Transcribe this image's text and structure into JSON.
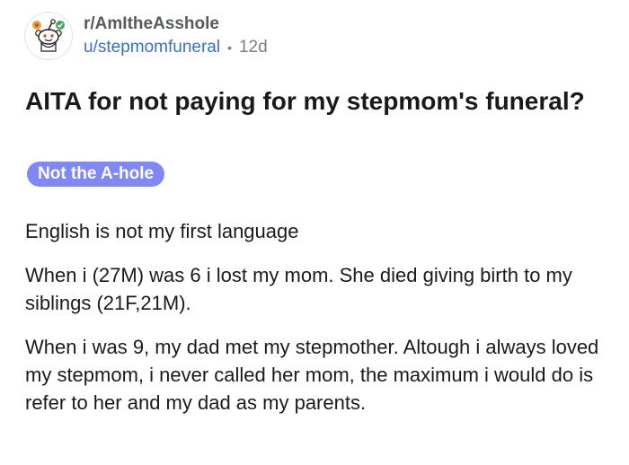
{
  "header": {
    "subreddit": "r/AmItheAsshole",
    "username": "u/stepmomfuneral",
    "separator": "•",
    "age": "12d",
    "avatar_icon": "reddit-snoo-avatar-icon"
  },
  "post": {
    "title": "AITA for not paying for my stepmom's funeral?",
    "flair": {
      "label": "Not the A-hole",
      "color": "#8088f5"
    },
    "paragraphs": [
      "English is not my first language",
      "When i (27M) was 6 i lost my mom. She died giving birth to my siblings (21F,21M).",
      "When i was 9, my dad met my stepmother. Altough i always loved my stepmom, i never called her mom, the maximum i would do is refer to her and my dad as my parents."
    ]
  },
  "colors": {
    "link": "#3a6fc4",
    "muted": "#7c7c7c",
    "text": "#1a1a1b"
  }
}
